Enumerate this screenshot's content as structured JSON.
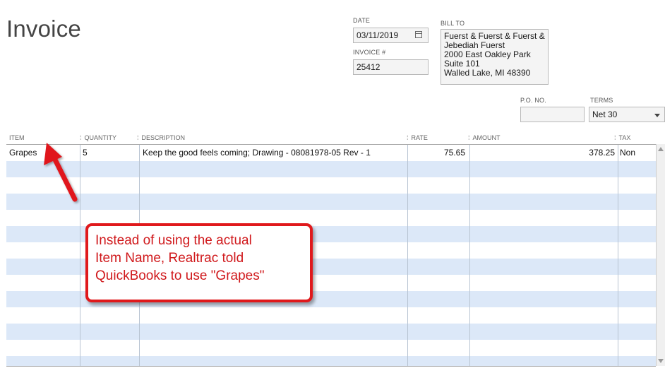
{
  "page": {
    "title": "Invoice"
  },
  "header": {
    "date_label": "DATE",
    "date_value": "03/11/2019",
    "invoice_label": "INVOICE #",
    "invoice_value": "25412",
    "bill_to_label": "BILL TO",
    "bill_to_lines": [
      "Fuerst & Fuerst & Fuerst &",
      "Jebediah Fuerst",
      "2000 East Oakley Park",
      "Suite 101",
      "Walled Lake, MI 48390"
    ],
    "po_label": "P.O. NO.",
    "po_value": "",
    "terms_label": "TERMS",
    "terms_value": "Net 30"
  },
  "table": {
    "columns": [
      "ITEM",
      "QUANTITY",
      "DESCRIPTION",
      "RATE",
      "AMOUNT",
      "TAX"
    ],
    "rows": [
      {
        "item": "Grapes",
        "quantity": "5",
        "description": "Keep the good feels coming; Drawing - 08081978-05 Rev - 1",
        "rate": "75.65",
        "amount": "378.25",
        "tax": "Non"
      }
    ]
  },
  "annotation": {
    "lines": [
      "Instead of using the actual",
      "Item Name, Realtrac told",
      "QuickBooks to use \"Grapes\""
    ],
    "color": "#e0191c"
  },
  "colors": {
    "row_alt": "#dce8f8"
  }
}
